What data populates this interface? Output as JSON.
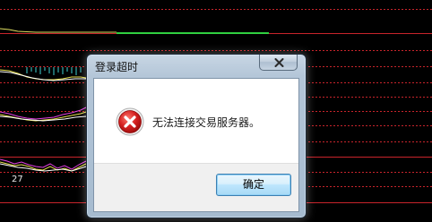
{
  "background": {
    "axis_number": "27"
  },
  "dialog": {
    "title": "登录超时",
    "message": "无法连接交易服务器。",
    "ok_label": "确定",
    "icon": "error-icon",
    "close_icon": "close-icon"
  },
  "colors": {
    "grid_line": "#c8242b",
    "error_red": "#cc1f1f",
    "ok_border": "#3c7fb1"
  }
}
